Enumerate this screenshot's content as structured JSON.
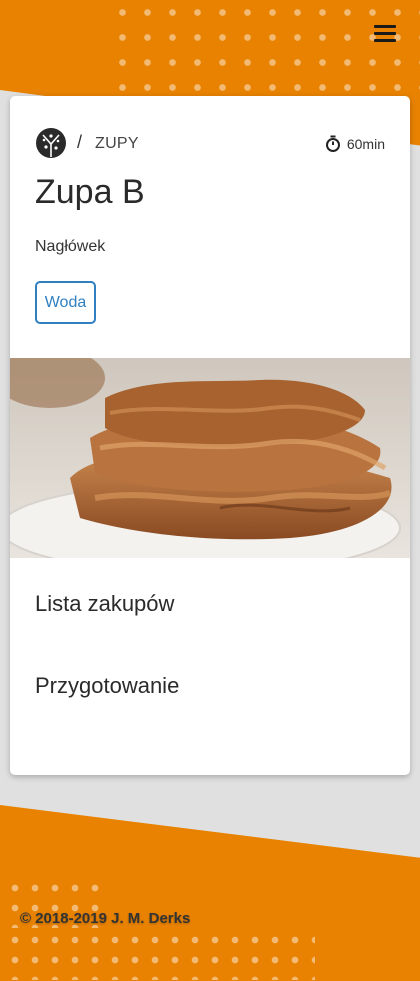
{
  "header": {
    "menu_icon": "hamburger-menu-icon"
  },
  "recipe": {
    "category_icon": "pizza-icon",
    "breadcrumb_separator": "/",
    "category": "ZUPY",
    "time_icon": "stopwatch-icon",
    "time": "60min",
    "title": "Zupa B",
    "subtitle": "Nagłówek",
    "tag": "Woda",
    "photo": "schnitzel-photo",
    "sections": {
      "shopping_list": "Lista zakupów",
      "preparation": "Przygotowanie"
    }
  },
  "footer": {
    "copyright": "© 2018-2019 J. M. Derks"
  },
  "colors": {
    "brand": "#e88200",
    "tag": "#2f7fc1",
    "background": "#e0e0e0"
  }
}
